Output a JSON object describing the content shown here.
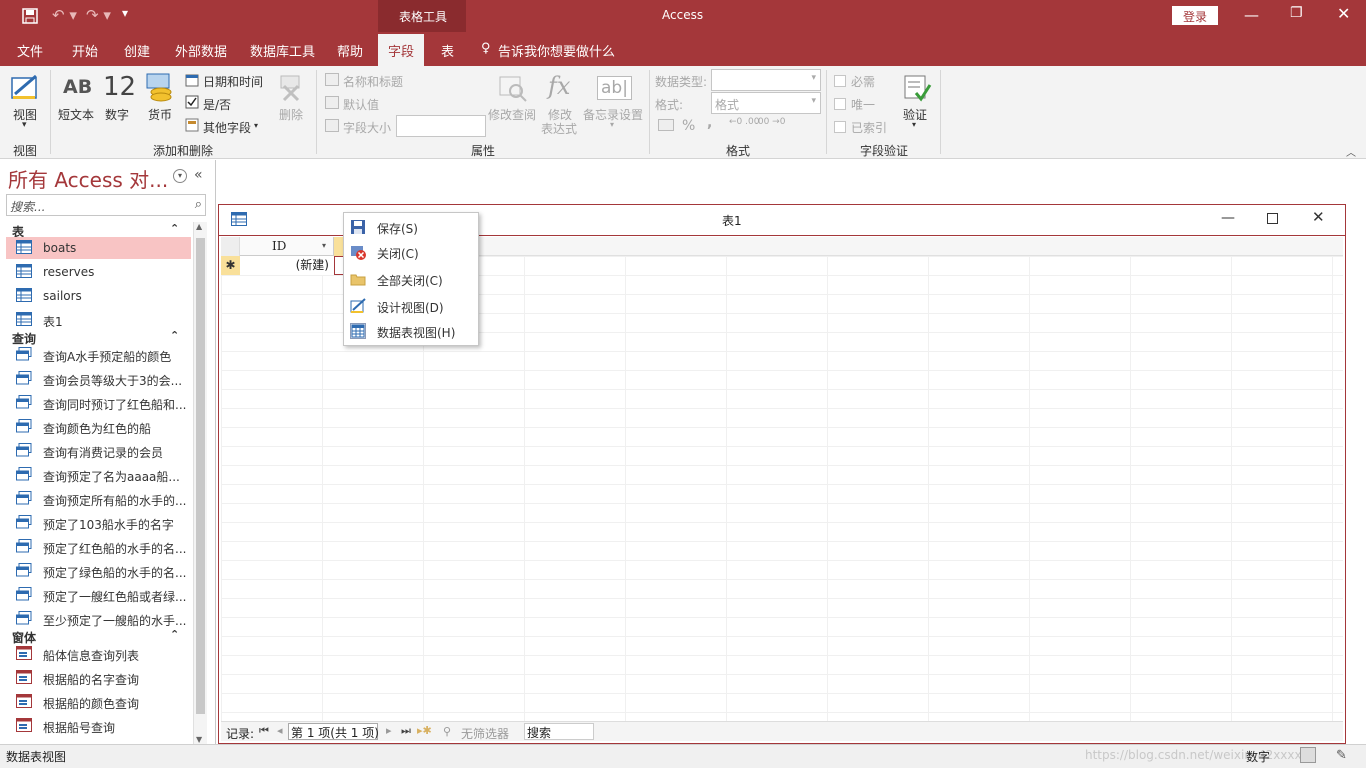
{
  "title_bar": {
    "app_title": "Access",
    "context_tab_group": "表格工具",
    "login_label": "登录"
  },
  "tabs": [
    "文件",
    "开始",
    "创建",
    "外部数据",
    "数据库工具",
    "帮助",
    "字段",
    "表"
  ],
  "tell_me": "告诉我你想要做什么",
  "ribbon": {
    "view": {
      "label": "视图",
      "group": "视图"
    },
    "add_delete": {
      "short_text": "短文本",
      "number": "数字",
      "number_glyph": "12",
      "text_glyph": "AB",
      "currency": "货币",
      "datetime": "日期和时间",
      "yesno": "是/否",
      "more_fields": "其他字段",
      "delete": "删除",
      "group": "添加和删除"
    },
    "properties": {
      "name_caption": "名称和标题",
      "default_value": "默认值",
      "field_size": "字段大小",
      "modify_lookups": "修改查阅",
      "modify_expr": "修改\n表达式",
      "memo_settings": "备忘录设置",
      "group": "属性",
      "fx_glyph": "fx",
      "ab_glyph": "ab|"
    },
    "format": {
      "data_type_label": "数据类型:",
      "format_label": "格式:",
      "format_value": "格式",
      "percent": "%",
      "comma": ",",
      "dec_inc": "←0 .00",
      "dec_dec": ".00 →0",
      "group": "格式"
    },
    "validation": {
      "required": "必需",
      "unique": "唯一",
      "indexed": "已索引",
      "validate": "验证",
      "group": "字段验证"
    }
  },
  "nav": {
    "title": "所有 Access 对...",
    "search_placeholder": "搜索...",
    "sections": [
      {
        "name": "表",
        "items": [
          "boats",
          "reserves",
          "sailors",
          "表1"
        ]
      },
      {
        "name": "查询",
        "items": [
          "查询A水手预定船的颜色",
          "查询会员等级大于3的会...",
          "查询同时预订了红色船和...",
          "查询颜色为红色的船",
          "查询有消费记录的会员",
          "查询预定了名为aaaa船...",
          "查询预定所有船的水手的...",
          "预定了103船水手的名字",
          "预定了红色船的水手的名...",
          "预定了绿色船的水手的名...",
          "预定了一艘红色船或者绿...",
          "至少预定了一艘船的水手..."
        ]
      },
      {
        "name": "窗体",
        "items": [
          "船体信息查询列表",
          "根据船的名字查询",
          "根据船的颜色查询",
          "根据船号查询"
        ]
      }
    ],
    "selected_item": "boats"
  },
  "doc": {
    "title": "表1",
    "column_header": "ID",
    "new_row_marker": "✱",
    "new_row_value": "(新建)"
  },
  "record_nav": {
    "label": "记录:",
    "position": "第 1 项(共 1 项)",
    "filter": "无筛选器",
    "search": "搜索"
  },
  "context_menu": [
    {
      "label": "保存(S)",
      "icon": "save-icon"
    },
    {
      "label": "关闭(C)",
      "icon": "close-doc-icon"
    },
    {
      "label": "全部关闭(C)",
      "icon": "folder-icon"
    },
    {
      "label": "设计视图(D)",
      "icon": "design-view-icon"
    },
    {
      "label": "数据表视图(H)",
      "icon": "datasheet-view-icon"
    }
  ],
  "status": {
    "left": "数据表视图",
    "right": "数字",
    "watermark": "https://blog.csdn.net/weixin_42xxxxxx"
  },
  "colors": {
    "accent": "#a4373a",
    "selected": "#f8c4c4"
  }
}
